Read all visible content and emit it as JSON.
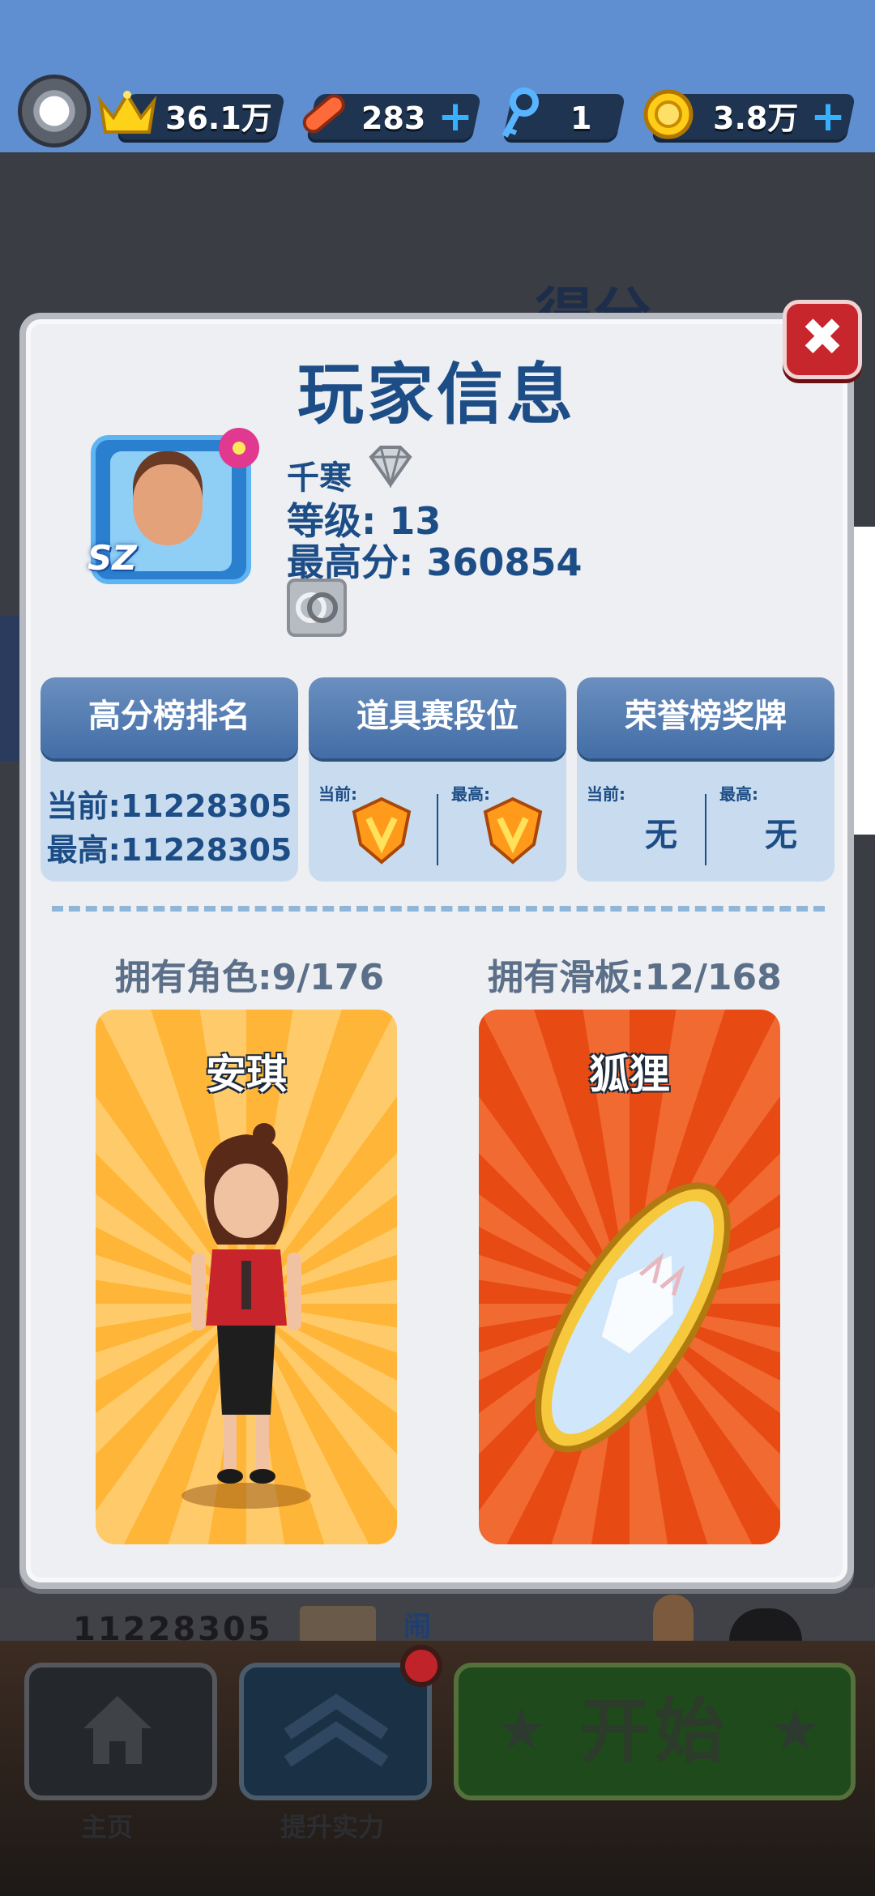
{
  "topbar": {
    "crowns": "36.1万",
    "boards": "283",
    "keys": "1",
    "coins": "3.8万",
    "plus": "+"
  },
  "background": {
    "score_title": "得分",
    "under_number": "11228305",
    "under_text": "闹"
  },
  "modal": {
    "title": "玩家信息",
    "close": "✖",
    "player": {
      "name": "千寒",
      "level": "等级: 13",
      "best": "最高分: 360854",
      "avatar_badge": "SZ"
    },
    "cards": {
      "leaderboard": {
        "title": "高分榜排名",
        "current": "当前:11228305",
        "best": "最高:11228305"
      },
      "items": {
        "title": "道具赛段位",
        "current_label": "当前:",
        "best_label": "最高:"
      },
      "honor": {
        "title": "荣誉榜奖牌",
        "current_label": "当前:",
        "best_label": "最高:",
        "current_value": "无",
        "best_value": "无"
      }
    },
    "owned_characters": "拥有角色:9/176",
    "owned_boards": "拥有滑板:12/168",
    "character_name": "安琪",
    "board_name": "狐狸"
  },
  "bottombar": {
    "home_label": "主页",
    "upgrade_label": "提升实力",
    "start_label": "开始"
  },
  "colors": {
    "topbar": "#5f8fd0",
    "modal_bg": "#eeeff2",
    "title_blue": "#1d4d86",
    "close_red": "#c7272c",
    "character_card": "#ffb638",
    "board_card": "#e84a13"
  }
}
